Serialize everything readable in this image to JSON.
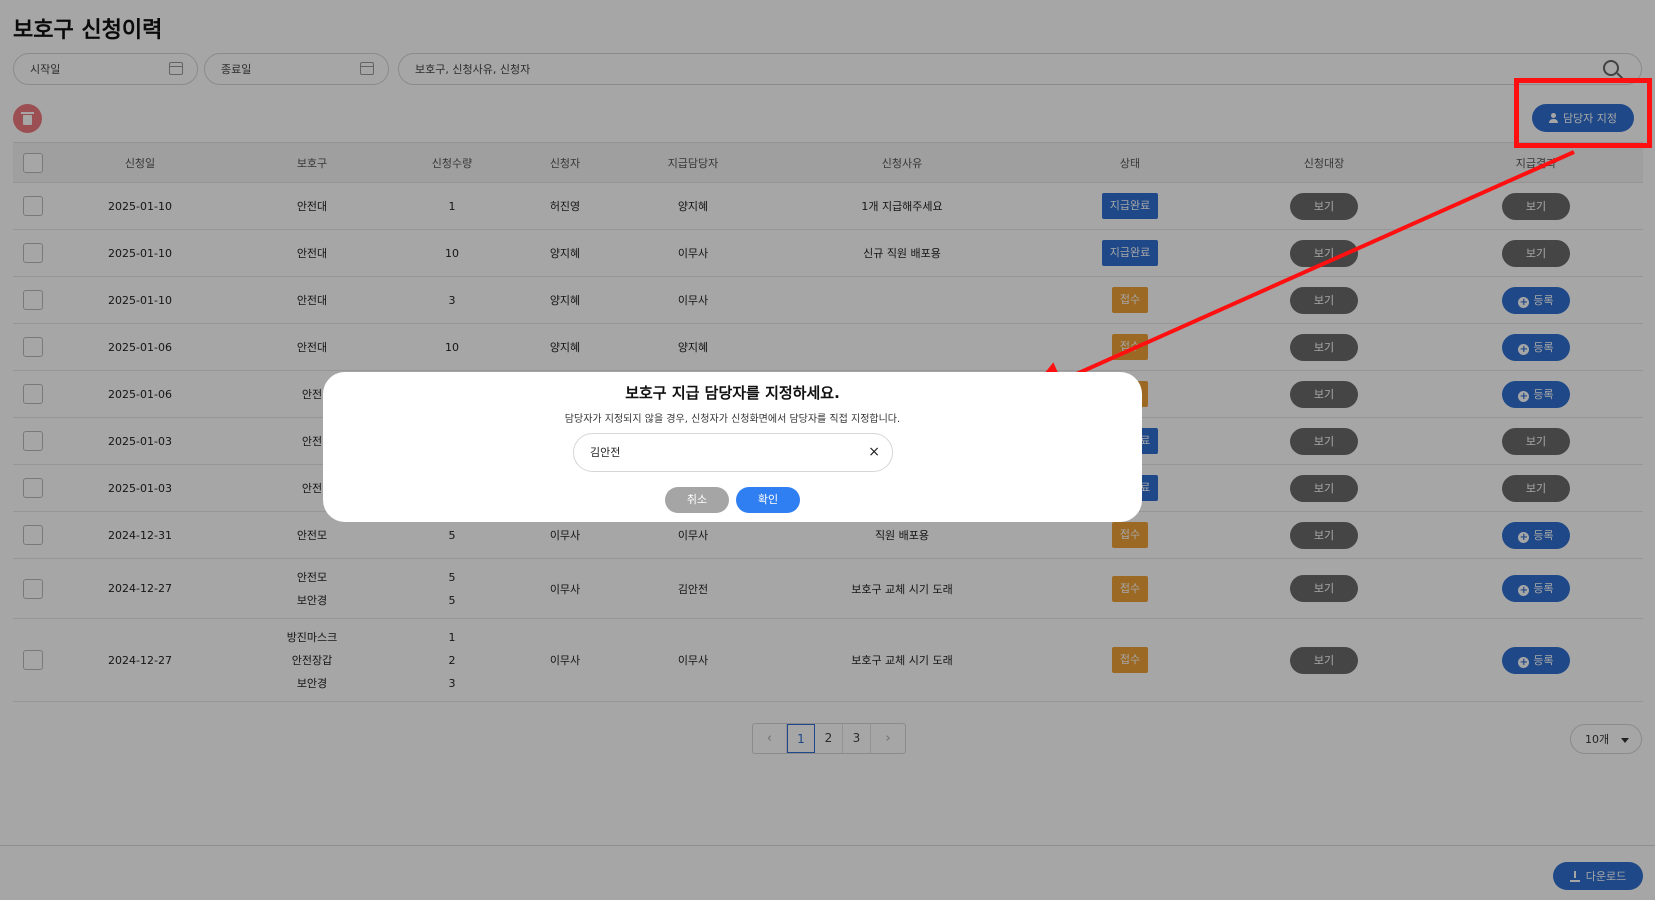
{
  "page": {
    "title": "보호구 신청이력"
  },
  "filters": {
    "start_placeholder": "시작일",
    "end_placeholder": "종료일",
    "search_placeholder": "보호구, 신청사유, 신청자"
  },
  "toolbar": {
    "assign_label": "담당자 지정"
  },
  "table": {
    "headers": [
      "신청일",
      "보호구",
      "신청수량",
      "신청자",
      "지급담당자",
      "신청사유",
      "상태",
      "신청대장",
      "지급결과"
    ],
    "rows": [
      {
        "date": "2025-01-10",
        "items": [
          "안전대"
        ],
        "qtys": [
          "1"
        ],
        "applicant": "허진영",
        "manager": "양지혜",
        "reason": "1개 지급해주세요",
        "status": "지급완료",
        "ledger": "보기",
        "result": "보기"
      },
      {
        "date": "2025-01-10",
        "items": [
          "안전대"
        ],
        "qtys": [
          "10"
        ],
        "applicant": "양지혜",
        "manager": "이무사",
        "reason": "신규 직원 배포용",
        "status": "지급완료",
        "ledger": "보기",
        "result": "보기"
      },
      {
        "date": "2025-01-10",
        "items": [
          "안전대"
        ],
        "qtys": [
          "3"
        ],
        "applicant": "양지혜",
        "manager": "이무사",
        "reason": "",
        "status": "접수",
        "ledger": "보기",
        "result": "등록"
      },
      {
        "date": "2025-01-06",
        "items": [
          "안전대"
        ],
        "qtys": [
          "10"
        ],
        "applicant": "양지혜",
        "manager": "양지혜",
        "reason": "",
        "status": "접수",
        "ledger": "보기",
        "result": "등록"
      },
      {
        "date": "2025-01-06",
        "items": [
          "안전"
        ],
        "qtys": [
          ""
        ],
        "applicant": "",
        "manager": "",
        "reason": "",
        "status": "접수",
        "ledger": "보기",
        "result": "등록"
      },
      {
        "date": "2025-01-03",
        "items": [
          "안전"
        ],
        "qtys": [
          ""
        ],
        "applicant": "",
        "manager": "",
        "reason": "",
        "status": "지급완료",
        "ledger": "보기",
        "result": "보기"
      },
      {
        "date": "2025-01-03",
        "items": [
          "안전"
        ],
        "qtys": [
          ""
        ],
        "applicant": "",
        "manager": "",
        "reason": "",
        "status": "지급완료",
        "ledger": "보기",
        "result": "보기"
      },
      {
        "date": "2024-12-31",
        "items": [
          "안전모"
        ],
        "qtys": [
          "5"
        ],
        "applicant": "이무사",
        "manager": "이무사",
        "reason": "직원 배포용",
        "status": "접수",
        "ledger": "보기",
        "result": "등록"
      },
      {
        "date": "2024-12-27",
        "items": [
          "안전모",
          "보안경"
        ],
        "qtys": [
          "5",
          "5"
        ],
        "applicant": "이무사",
        "manager": "김안전",
        "reason": "보호구 교체 시기 도래",
        "status": "접수",
        "ledger": "보기",
        "result": "등록"
      },
      {
        "date": "2024-12-27",
        "items": [
          "방진마스크",
          "안전장갑",
          "보안경"
        ],
        "qtys": [
          "1",
          "2",
          "3"
        ],
        "applicant": "이무사",
        "manager": "이무사",
        "reason": "보호구 교체 시기 도래",
        "status": "접수",
        "ledger": "보기",
        "result": "등록"
      }
    ]
  },
  "pagination": {
    "prev": "‹",
    "pages": [
      "1",
      "2",
      "3"
    ],
    "current": "1",
    "next": "›"
  },
  "page_size": {
    "selected": "10개"
  },
  "footer": {
    "download_label": "다운로드"
  },
  "modal": {
    "title": "보호구 지급 담당자를 지정하세요.",
    "description": "담당자가 지정되지 않을 경우, 신청자가 신청화면에서 담당자를 직접 지정합니다.",
    "input_value": "김안전",
    "clear_symbol": "×",
    "cancel_label": "취소",
    "confirm_label": "확인"
  },
  "colors": {
    "primary": "#2f6fd2",
    "status_done": "#2f6fd2",
    "status_received": "#f0a23a",
    "view_button": "#6a6a6a",
    "annotation": "#ff1010",
    "delete": "#f07a7e"
  }
}
